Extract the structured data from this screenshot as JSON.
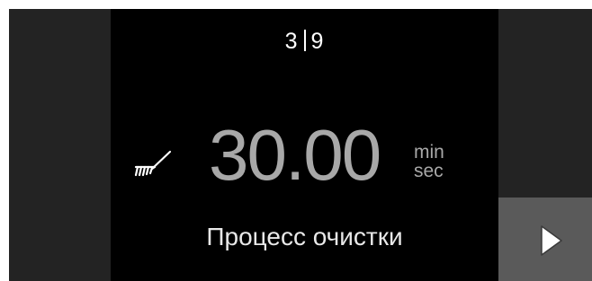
{
  "step": {
    "current": "3",
    "total": "9"
  },
  "timer": {
    "value": "30.00",
    "unit_top": "min",
    "unit_bottom": "sec"
  },
  "program": {
    "label": "Процесс очистки",
    "icon": "brush-icon"
  },
  "controls": {
    "next_icon": "play-icon"
  },
  "colors": {
    "background": "#000000",
    "side_panel": "#232323",
    "next_button": "#5a5a5a",
    "timer_text": "#a8a8a8",
    "label_text": "#e8e8e8"
  }
}
